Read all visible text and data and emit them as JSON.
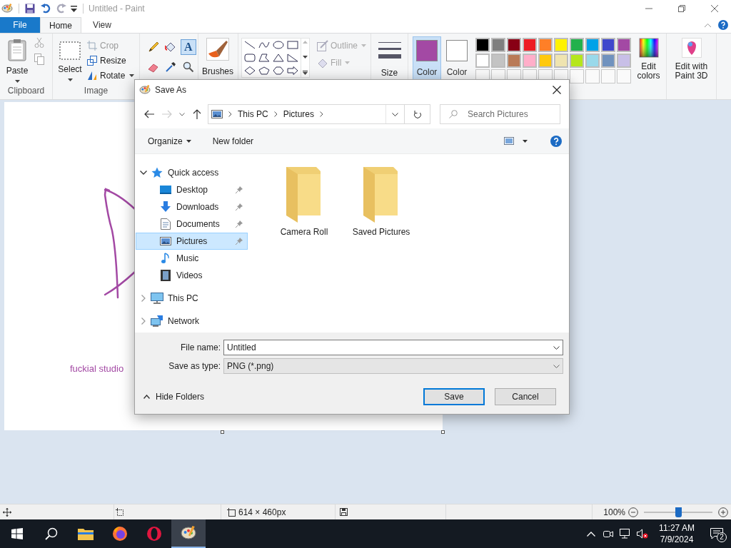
{
  "app": {
    "title": "Untitled - Paint"
  },
  "ribbon_tabs": [
    {
      "label": "File",
      "kind": "file",
      "selected": false
    },
    {
      "label": "Home",
      "kind": "tab",
      "selected": true
    },
    {
      "label": "View",
      "kind": "tab",
      "selected": false
    }
  ],
  "clipboard": {
    "paste": "Paste",
    "group": "Clipboard"
  },
  "image": {
    "select": "Select",
    "crop": "Crop",
    "resize": "Resize",
    "rotate": "Rotate",
    "group": "Image"
  },
  "tools": [
    {
      "kind": "pencil",
      "selected": false
    },
    {
      "kind": "fill",
      "selected": false
    },
    {
      "kind": "text",
      "glyph": "A",
      "selected": true
    },
    {
      "kind": "eraser",
      "selected": false
    },
    {
      "kind": "picker",
      "selected": false
    },
    {
      "kind": "magnifier",
      "selected": false
    }
  ],
  "brushes": "Brushes",
  "shapes": {
    "outline": {
      "label": "Outline",
      "disabled": true
    },
    "fill": {
      "label": "Fill",
      "disabled": true
    }
  },
  "size": "Size",
  "colors": [
    {
      "label": "Color",
      "color": "#a349a4",
      "selected": true
    },
    {
      "label": "Color",
      "color": "#ffffff",
      "selected": false
    }
  ],
  "palette": [
    {
      "color": "#000000"
    },
    {
      "color": "#7f7f7f"
    },
    {
      "color": "#880015"
    },
    {
      "color": "#ed1c24"
    },
    {
      "color": "#ff7f27"
    },
    {
      "color": "#fff200"
    },
    {
      "color": "#22b14c"
    },
    {
      "color": "#00a2e8"
    },
    {
      "color": "#3f48cc"
    },
    {
      "color": "#a349a4"
    },
    {
      "color": "#ffffff"
    },
    {
      "color": "#c3c3c3"
    },
    {
      "color": "#b97a57"
    },
    {
      "color": "#ffaec9"
    },
    {
      "color": "#ffc90e"
    },
    {
      "color": "#efe4b0"
    },
    {
      "color": "#b5e61d"
    },
    {
      "color": "#99d9ea"
    },
    {
      "color": "#7092be"
    },
    {
      "color": "#c8bfe7"
    }
  ],
  "edit_colors": "Edit colors",
  "paint3d": "Edit with Paint 3D",
  "canvas": {
    "text": "fuckial studio"
  },
  "dialog": {
    "title": "Save As",
    "address": [
      "This PC",
      "Pictures"
    ],
    "search": {
      "placeholder": "Search Pictures"
    },
    "toolbar": {
      "organize": "Organize",
      "new_folder": "New folder"
    },
    "tree": [
      {
        "label": "Quick access",
        "kind": "star",
        "expanded": true,
        "selected": false,
        "children": [
          {
            "label": "Desktop",
            "kind": "desktop",
            "pinned": true,
            "selected": false
          },
          {
            "label": "Downloads",
            "kind": "downloads",
            "pinned": true,
            "selected": false
          },
          {
            "label": "Documents",
            "kind": "documents",
            "pinned": true,
            "selected": false
          },
          {
            "label": "Pictures",
            "kind": "pictures",
            "pinned": true,
            "selected": true
          },
          {
            "label": "Music",
            "kind": "music",
            "pinned": false,
            "selected": false
          },
          {
            "label": "Videos",
            "kind": "videos",
            "pinned": false,
            "selected": false
          }
        ]
      },
      {
        "label": "This PC",
        "kind": "pc",
        "expanded": false,
        "selected": false
      },
      {
        "label": "Network",
        "kind": "network",
        "expanded": false,
        "selected": false
      }
    ],
    "folders": [
      {
        "label": "Camera Roll"
      },
      {
        "label": "Saved Pictures"
      }
    ],
    "file_name": {
      "label": "File name:",
      "value": "Untitled"
    },
    "save_type": {
      "label": "Save as type:",
      "value": "PNG (*.png)"
    },
    "hide_folders": "Hide Folders",
    "buttons": [
      "Save",
      "Cancel"
    ]
  },
  "status_bar": {
    "dimensions": "614 × 460px",
    "zoom": "100%",
    "zoom_slider": {
      "level": 0.5
    }
  },
  "taskbar": {
    "apps": [
      {
        "kind": "search",
        "selected": false
      },
      {
        "kind": "explorer",
        "selected": false
      },
      {
        "kind": "firefox",
        "selected": false
      },
      {
        "kind": "opera",
        "selected": false
      },
      {
        "kind": "paint",
        "selected": true
      }
    ],
    "time": "11:27 AM",
    "date": "7/9/2024",
    "notifications": "2"
  }
}
